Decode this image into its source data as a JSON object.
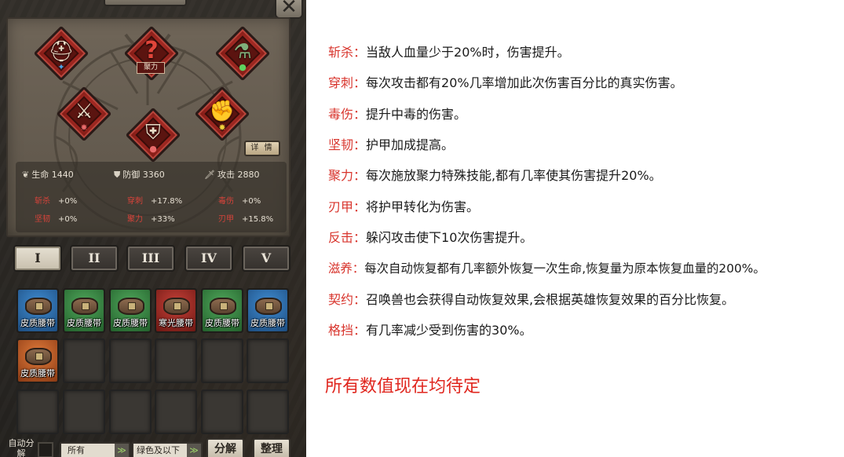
{
  "game": {
    "close_glyph": "✕",
    "focus_label": "聚力",
    "unknown_glyph": "?",
    "detail_button": "详 情",
    "main_stats": [
      {
        "icon": "heart-icon",
        "label": "生命",
        "value": "1440"
      },
      {
        "icon": "shield-icon",
        "label": "防御",
        "value": "3360"
      },
      {
        "icon": "sword-icon",
        "label": "攻击",
        "value": "2880"
      }
    ],
    "sub_stats": [
      {
        "label": "斩杀",
        "value": "+0%"
      },
      {
        "label": "穿刺",
        "value": "+17.8%"
      },
      {
        "label": "毒伤",
        "value": "+0%"
      },
      {
        "label": "坚韧",
        "value": "+0%"
      },
      {
        "label": "聚力",
        "value": "+33%"
      },
      {
        "label": "刃甲",
        "value": "+15.8%"
      }
    ],
    "tiers": [
      "I",
      "II",
      "III",
      "IV",
      "V"
    ],
    "active_tier": "I",
    "items": [
      {
        "name": "皮质腰带",
        "rarity": "blue"
      },
      {
        "name": "皮质腰带",
        "rarity": "green"
      },
      {
        "name": "皮质腰带",
        "rarity": "green"
      },
      {
        "name": "寒光腰带",
        "rarity": "red"
      },
      {
        "name": "皮质腰带",
        "rarity": "green"
      },
      {
        "name": "皮质腰带",
        "rarity": "blue"
      },
      {
        "name": "皮质腰带",
        "rarity": "orange"
      }
    ],
    "bottom": {
      "auto_label": "自动分解",
      "filter_all": "所有",
      "filter_quality": "绿色及以下",
      "decompose_button": "分解",
      "sort_button": "整理"
    }
  },
  "descriptions": [
    {
      "term": "斩杀：",
      "text": "当敌人血量少于20%时，伤害提升。"
    },
    {
      "term": "穿刺：",
      "text": "每次攻击都有20%几率增加此次伤害百分比的真实伤害。"
    },
    {
      "term": "毒伤：",
      "text": "提升中毒的伤害。"
    },
    {
      "term": "坚韧：",
      "text": "护甲加成提高。"
    },
    {
      "term": "聚力：",
      "text": "每次施放聚力特殊技能,都有几率使其伤害提升20%。"
    },
    {
      "term": "刃甲：",
      "text": "将护甲转化为伤害。"
    },
    {
      "term": "反击：",
      "text": "躲闪攻击使下10次伤害提升。"
    },
    {
      "term": "滋养：",
      "text": "每次自动恢复都有几率额外恢复一次生命,恢复量为原本恢复血量的200%。"
    },
    {
      "term": "契约：",
      "text": "召唤兽也会获得自动恢复效果,会根据英雄恢复效果的百分比恢复。"
    },
    {
      "term": "格挡：",
      "text": "有几率减少受到伤害的30%。"
    }
  ],
  "notice": "所有数值现在均待定",
  "colors": {
    "term": "#d8342c",
    "notice": "#e0261e",
    "panel": "#2c2a27"
  }
}
